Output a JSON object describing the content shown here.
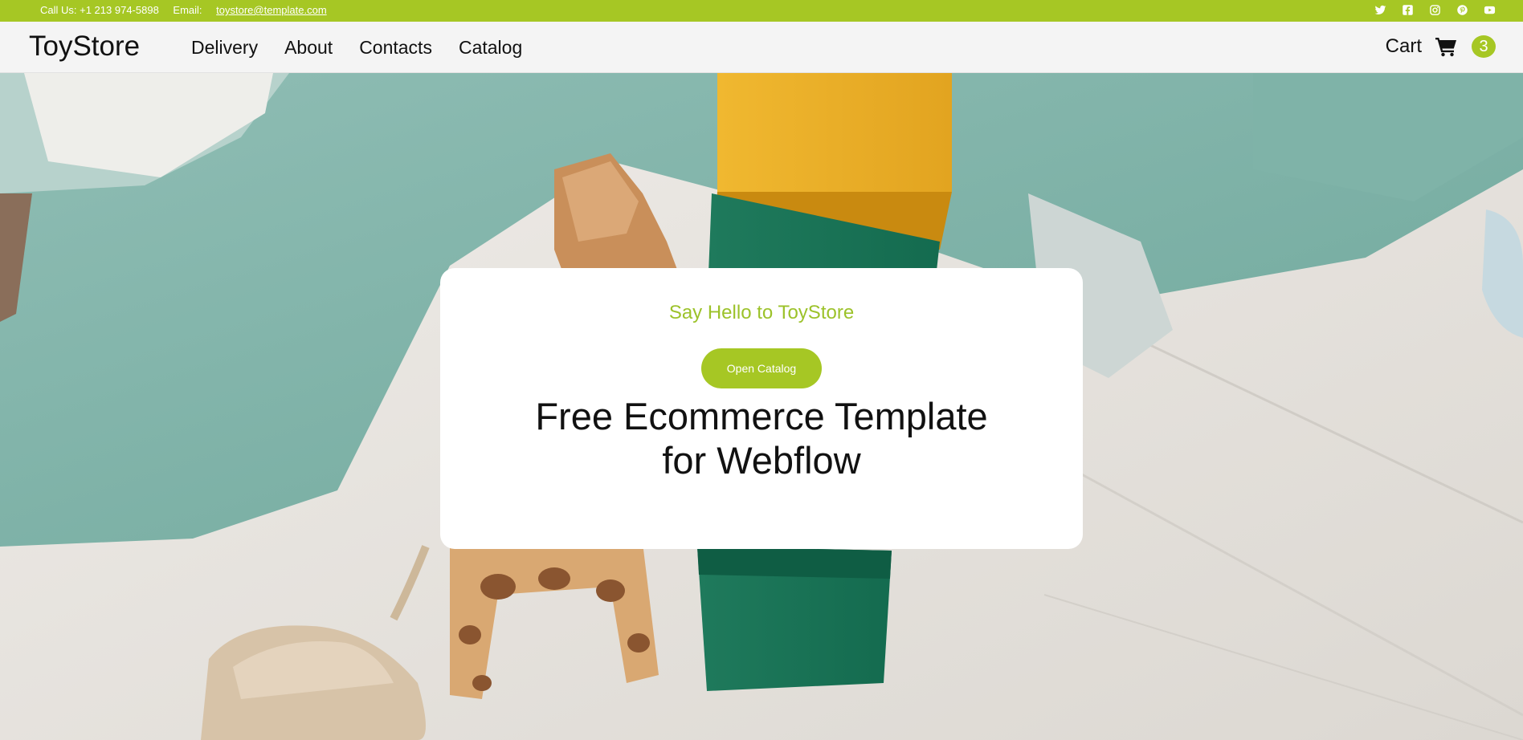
{
  "topbar": {
    "phone_text": "Call Us: +1 213 974-5898",
    "email_label": "Email:",
    "email_link": "toystore@template.com",
    "socials": [
      "twitter-icon",
      "facebook-icon",
      "instagram-icon",
      "pinterest-icon",
      "youtube-icon"
    ]
  },
  "nav": {
    "brand": "ToyStore",
    "links": [
      "Delivery",
      "About",
      "Contacts",
      "Catalog"
    ],
    "cart_label": "Cart",
    "cart_icon": "cart-icon",
    "cart_count": "3"
  },
  "hero": {
    "eyebrow": "Say Hello to ToyStore",
    "button_label": "Open Catalog",
    "headline": "Free Ecommerce Template for Webflow"
  },
  "colors": {
    "accent": "#a6c724",
    "eyebrow": "#9cc22a",
    "nav_background": "#f4f4f4",
    "text": "#111111"
  }
}
